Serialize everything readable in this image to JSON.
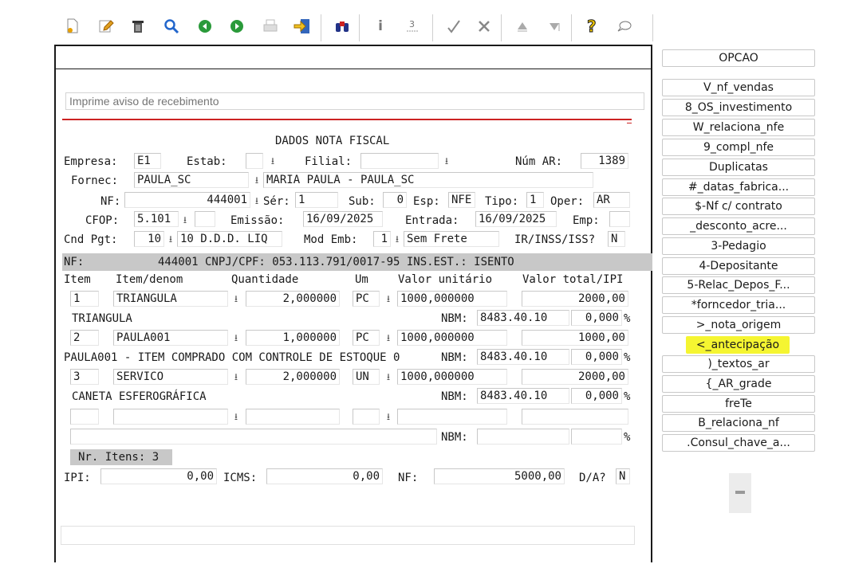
{
  "toolbar": {
    "icons": [
      "new-document-icon",
      "edit-pencil-icon",
      "trash-icon",
      "search-icon",
      "green-back-icon",
      "green-forward-icon",
      "print-icon",
      "export-arrow-icon",
      "binoculars-icon",
      "info-icon",
      "calculator-icon",
      "checkmark-icon",
      "tools-icon",
      "up-triangle-icon",
      "down-triangle-icon",
      "help-icon",
      "speech-bubble-icon"
    ]
  },
  "form": {
    "title_placeholder": "Imprime aviso de recebimento",
    "section_title": "DADOS NOTA FISCAL",
    "empresa_label": "Empresa:",
    "empresa": "E1",
    "estab_label": "Estab:",
    "estab": "",
    "filial_label": "Filial:",
    "filial": "",
    "num_ar_label": "Núm AR:",
    "num_ar": "1389",
    "fornec_label": "Fornec:",
    "fornec": "PAULA_SC",
    "fornec_name": "MARIA PAULA - PAULA_SC",
    "nf_label": "NF:",
    "nf": "444001",
    "ser_label": "Sér:",
    "ser": "1",
    "sub_label": "Sub:",
    "sub": "0",
    "esp_label": "Esp:",
    "esp": "NFE",
    "tipo_label": "Tipo:",
    "tipo": "1",
    "oper_label": "Oper:",
    "oper": "AR",
    "cfop_label": "CFOP:",
    "cfop": "5.101",
    "cfop_extra": "",
    "emissao_label": "Emissão:",
    "emissao": "16/09/2025",
    "entrada_label": "Entrada:",
    "entrada": "16/09/2025",
    "emp_label": "Emp:",
    "emp": "",
    "cnd_label": "Cnd Pgt:",
    "cnd_code": "10",
    "cnd_desc": "10 D.D.D. LIQ",
    "mod_label": "Mod Emb:",
    "mod_code": "1",
    "mod_desc": "Sem Frete",
    "ir_label": "IR/INSS/ISS?",
    "ir": "N",
    "info_band": "NF:           444001 CNPJ/CPF: 053.113.791/0017-95 INS.EST.: ISENTO"
  },
  "items": {
    "headers": {
      "item": "Item",
      "denom": "Item/denom",
      "qty": "Quantidade",
      "um": "Um",
      "unit": "Valor unitário",
      "total": "Valor total/IPI"
    },
    "nbm_label": "NBM:",
    "pct": "%",
    "rows": [
      {
        "item": "1",
        "code": "TRIANGULA",
        "qty": "2,000000",
        "um": "PC",
        "unit": "1000,000000",
        "total": "2000,00",
        "desc": "TRIANGULA",
        "nbm": "8483.40.10",
        "ipi": "0,000"
      },
      {
        "item": "2",
        "code": "PAULA001",
        "qty": "1,000000",
        "um": "PC",
        "unit": "1000,000000",
        "total": "1000,00",
        "desc": "PAULA001 - ITEM COMPRADO COM CONTROLE DE ESTOQUE 0",
        "nbm": "8483.40.10",
        "ipi": "0,000"
      },
      {
        "item": "3",
        "code": "SERVICO",
        "qty": "2,000000",
        "um": "UN",
        "unit": "1000,000000",
        "total": "2000,00",
        "desc": "CANETA ESFEROGRÁFICA",
        "nbm": "8483.40.10",
        "ipi": "0,000"
      },
      {
        "item": "",
        "code": "",
        "qty": "",
        "um": "",
        "unit": "",
        "total": "",
        "desc": "",
        "nbm": "",
        "ipi": ""
      }
    ],
    "count_label": "Nr. Itens: 3"
  },
  "totals": {
    "ipi_label": "IPI:",
    "ipi": "0,00",
    "icms_label": "ICMS:",
    "icms": "0,00",
    "nf_label": "NF:",
    "nf": "5000,00",
    "da_label": "D/A?",
    "da": "N"
  },
  "options": {
    "header": "OPCAO",
    "items": [
      "V_nf_vendas",
      "8_OS_investimento",
      "W_relaciona_nfe",
      "9_compl_nfe",
      "Duplicatas",
      "#_datas_fabrica...",
      "$-Nf c/ contrato",
      "_desconto_acre...",
      "3-Pedagio",
      "4-Depositante",
      "5-Relac_Depos_F...",
      "*forncedor_tria...",
      ">_nota_origem",
      "<_antecipação",
      ")_textos_ar",
      "{_AR_grade",
      "freTe",
      "B_relaciona_nf",
      ".Consul_chave_a..."
    ],
    "highlighted_index": 13,
    "highlight_color": "#f5f531"
  }
}
